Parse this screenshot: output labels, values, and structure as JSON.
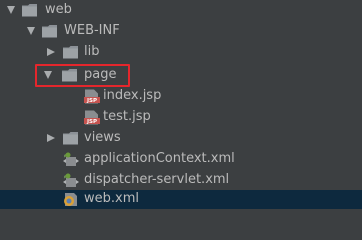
{
  "tree": {
    "items": [
      {
        "label": "web",
        "icon": "folder-icon",
        "expanded": true
      },
      {
        "label": "WEB-INF",
        "icon": "folder-icon",
        "expanded": true
      },
      {
        "label": "lib",
        "icon": "folder-icon",
        "expanded": false
      },
      {
        "label": "page",
        "icon": "folder-icon",
        "expanded": true
      },
      {
        "label": "index.jsp",
        "icon": "jsp-file-icon"
      },
      {
        "label": "test.jsp",
        "icon": "jsp-file-icon"
      },
      {
        "label": "views",
        "icon": "folder-icon",
        "expanded": false
      },
      {
        "label": "applicationContext.xml",
        "icon": "spring-xml-file-icon"
      },
      {
        "label": "dispatcher-servlet.xml",
        "icon": "spring-xml-file-icon"
      },
      {
        "label": "web.xml",
        "icon": "web-xml-file-icon",
        "selected": true
      }
    ],
    "jsp_badge": "JSP"
  },
  "colors": {
    "background": "#3c3f41",
    "text": "#bbbbbb",
    "selection": "#0d293e",
    "folder": "#8c9197",
    "highlight": "#e5262c"
  }
}
